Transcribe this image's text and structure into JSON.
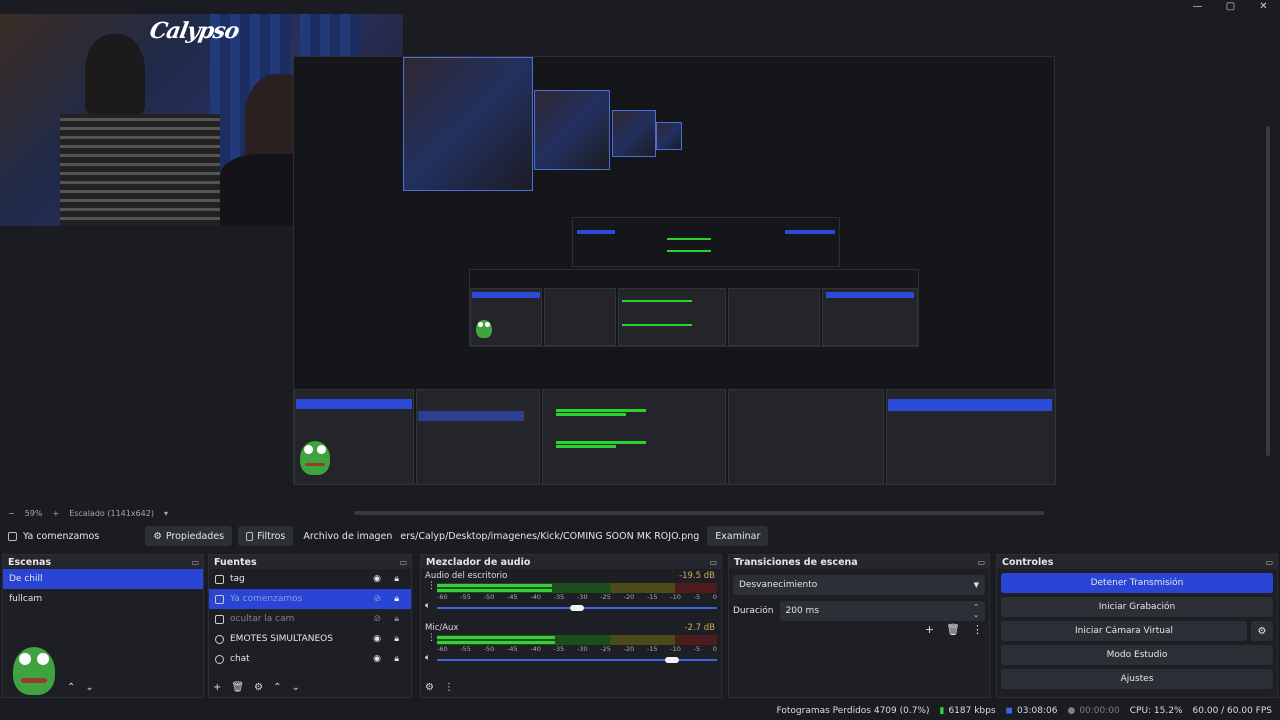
{
  "window_controls": {
    "minimize": "—",
    "maximize": "▢",
    "close": "✕"
  },
  "preview": {
    "logo_text": "Calypso",
    "zoom_minus": "−",
    "zoom_level": "59%",
    "zoom_plus": "+",
    "scale_label": "Escalado (1141x642)",
    "scale_arrow": "▾"
  },
  "propbar": {
    "source_name": "Ya comenzamos",
    "properties_label": "Propiedades",
    "filters_label": "Filtros",
    "image_file_label": "Archivo de imagen",
    "file_path": "ers/Calyp/Desktop/imagenes/Kick/COMING SOON MK ROJO.png",
    "browse_label": "Examinar"
  },
  "scenes": {
    "title": "Escenas",
    "items": [
      {
        "label": "De chill",
        "selected": true
      },
      {
        "label": "fullcam",
        "selected": false
      }
    ]
  },
  "sources": {
    "title": "Fuentes",
    "items": [
      {
        "label": "tag",
        "dim": false
      },
      {
        "label": "Ya comenzamos",
        "dim": true,
        "selected": true
      },
      {
        "label": "ocultar la cam",
        "dim": true
      },
      {
        "label": "EMOTES SIMULTANEOS",
        "dim": false
      },
      {
        "label": "chat",
        "dim": false
      }
    ]
  },
  "mixer": {
    "title": "Mezclador de audio",
    "ticks": [
      "-60",
      "-55",
      "-50",
      "-45",
      "-40",
      "-35",
      "-30",
      "-25",
      "-20",
      "-15",
      "-10",
      "-5",
      "0"
    ],
    "channels": [
      {
        "name": "Audio del escritorio",
        "db": "-19.5 dB",
        "level": 0.41,
        "volume": 0.5
      },
      {
        "name": "Mic/Aux",
        "db": "-2.7 dB",
        "level": 0.42,
        "volume": 0.84
      }
    ]
  },
  "transitions": {
    "title": "Transiciones de escena",
    "type": "Desvanecimiento",
    "duration_label": "Duración",
    "duration_value": "200 ms"
  },
  "controls": {
    "title": "Controles",
    "stop_stream": "Detener Transmisión",
    "start_record": "Iniciar Grabación",
    "virtual_cam": "Iniciar Cámara Virtual",
    "studio_mode": "Modo Estudio",
    "settings": "Ajustes"
  },
  "status": {
    "dropped_frames": "Fotogramas Perdidos 4709 (0.7%)",
    "bitrate": "6187 kbps",
    "stream_time": "03:08:06",
    "record_time": "00:00:00",
    "cpu": "CPU: 15.2%",
    "fps": "60.00 / 60.00 FPS"
  },
  "colors": {
    "accent": "#2a45d6",
    "background": "#1b1c21",
    "meter_green": "#35d035",
    "db_text": "#cfa860"
  }
}
